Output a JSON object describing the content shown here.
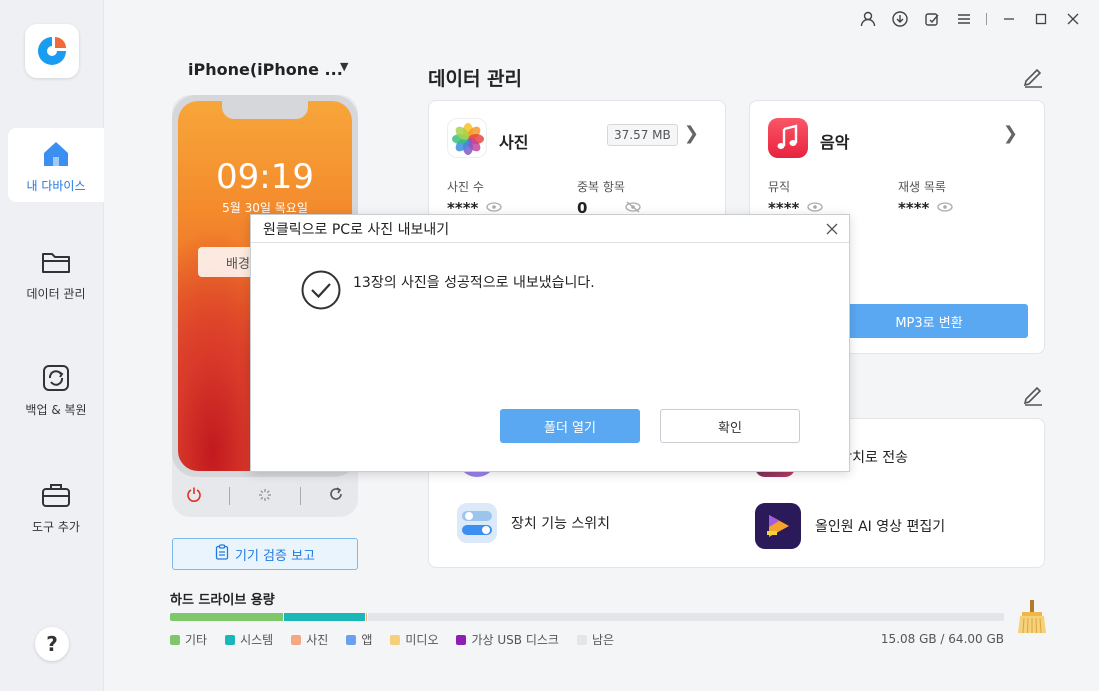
{
  "titlebar": {
    "icons": [
      "user-icon",
      "download-icon",
      "feedback-icon",
      "menu-icon",
      "minimize-icon",
      "maximize-icon",
      "close-icon"
    ]
  },
  "sidebar": {
    "items": [
      {
        "label": "내 다바이스",
        "icon": "home-icon",
        "active": true
      },
      {
        "label": "데이터 관리",
        "icon": "folder-icon",
        "active": false
      },
      {
        "label": "백업 & 복원",
        "icon": "backup-icon",
        "active": false
      },
      {
        "label": "도구 추가",
        "icon": "toolbox-icon",
        "active": false
      }
    ],
    "help": "?"
  },
  "device": {
    "name": "iPhone(iPhone ...",
    "clock": "09:19",
    "date": "5월 30일 목요일",
    "wallpaper_label": "배경",
    "report_label": "기기 검증 보고"
  },
  "storage": {
    "title": "하드 드라이브 용량",
    "size": "15.08 GB / 64.00 GB",
    "segments": [
      {
        "label": "기타",
        "color": "#7ec76a",
        "fraction": 0.137
      },
      {
        "label": "시스템",
        "color": "#19b7b7",
        "fraction": 0.098
      },
      {
        "label": "사진",
        "color": "#f5a882",
        "fraction": 0.002
      },
      {
        "label": "앱",
        "color": "#6b9ff0",
        "fraction": 0.0
      },
      {
        "label": "미디오",
        "color": "#f7cf7a",
        "fraction": 0.0
      },
      {
        "label": "가상 USB 디스크",
        "color": "#8e1fb5",
        "fraction": 0.0
      },
      {
        "label": "남은",
        "color": "#e3e5e8",
        "fraction": 0.0
      }
    ]
  },
  "data_management": {
    "title": "데이터 관리",
    "photo": {
      "title": "사진",
      "size": "37.57 MB",
      "stat1_label": "사진 수",
      "stat1_value": "****",
      "stat2_label": "중복 항목",
      "stat2_value": "0"
    },
    "music": {
      "title": "음악",
      "stat1_label": "뮤직",
      "stat1_value": "****",
      "stat2_label": "재생 목록",
      "stat2_value": "****",
      "mp3_label": "MP3로 변환"
    },
    "tools": {
      "transfer_label": "에서 장치로 전송",
      "switch_label": "장치 기능 스위치",
      "video_label": "올인원 AI 영상 편집기"
    }
  },
  "dialog": {
    "title": "원클릭으로 PC로 사진 내보내기",
    "message": "13장의 사진을 성공적으로 내보냈습니다.",
    "open_folder": "폴더 열기",
    "confirm": "확인"
  },
  "colors": {
    "accent": "#5aa8f2",
    "active_nav": "#1f7ae0",
    "power_red": "#e0312b"
  }
}
